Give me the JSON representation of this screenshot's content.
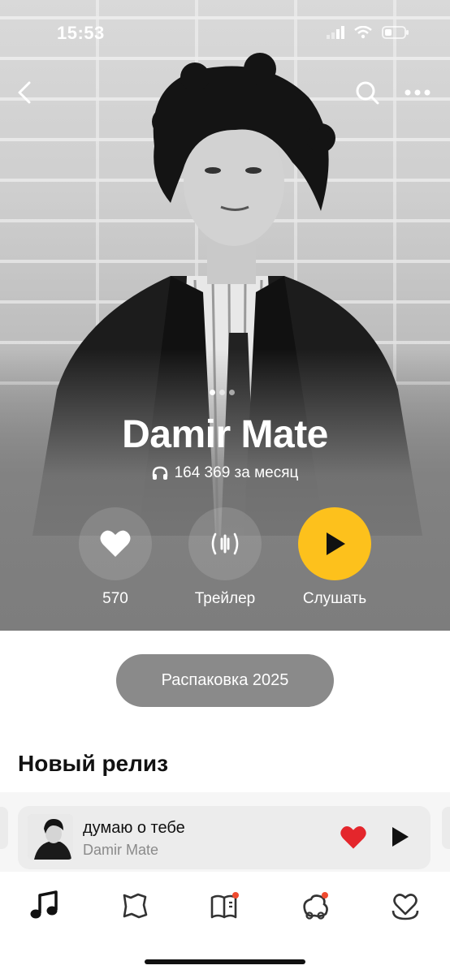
{
  "status_bar": {
    "time": "15:53"
  },
  "artist": {
    "name": "Damir Mate",
    "listeners": "164 369 за месяц"
  },
  "actions": {
    "like_count": "570",
    "trailer_label": "Трейлер",
    "listen_label": "Слушать"
  },
  "unpack_label": "Распаковка 2025",
  "section_title": "Новый релиз",
  "mini_player": {
    "title": "думаю о тебе",
    "artist": "Damir Mate"
  },
  "colors": {
    "accent": "#fdc11c",
    "like_red": "#e4262c",
    "hero_grey": "#7d7d7d"
  },
  "icons": {
    "nav": [
      "back-icon",
      "search-icon",
      "more-icon"
    ],
    "tabs": [
      "music-icon",
      "map-icon",
      "book-icon",
      "kids-icon",
      "heart-badge-icon"
    ]
  }
}
